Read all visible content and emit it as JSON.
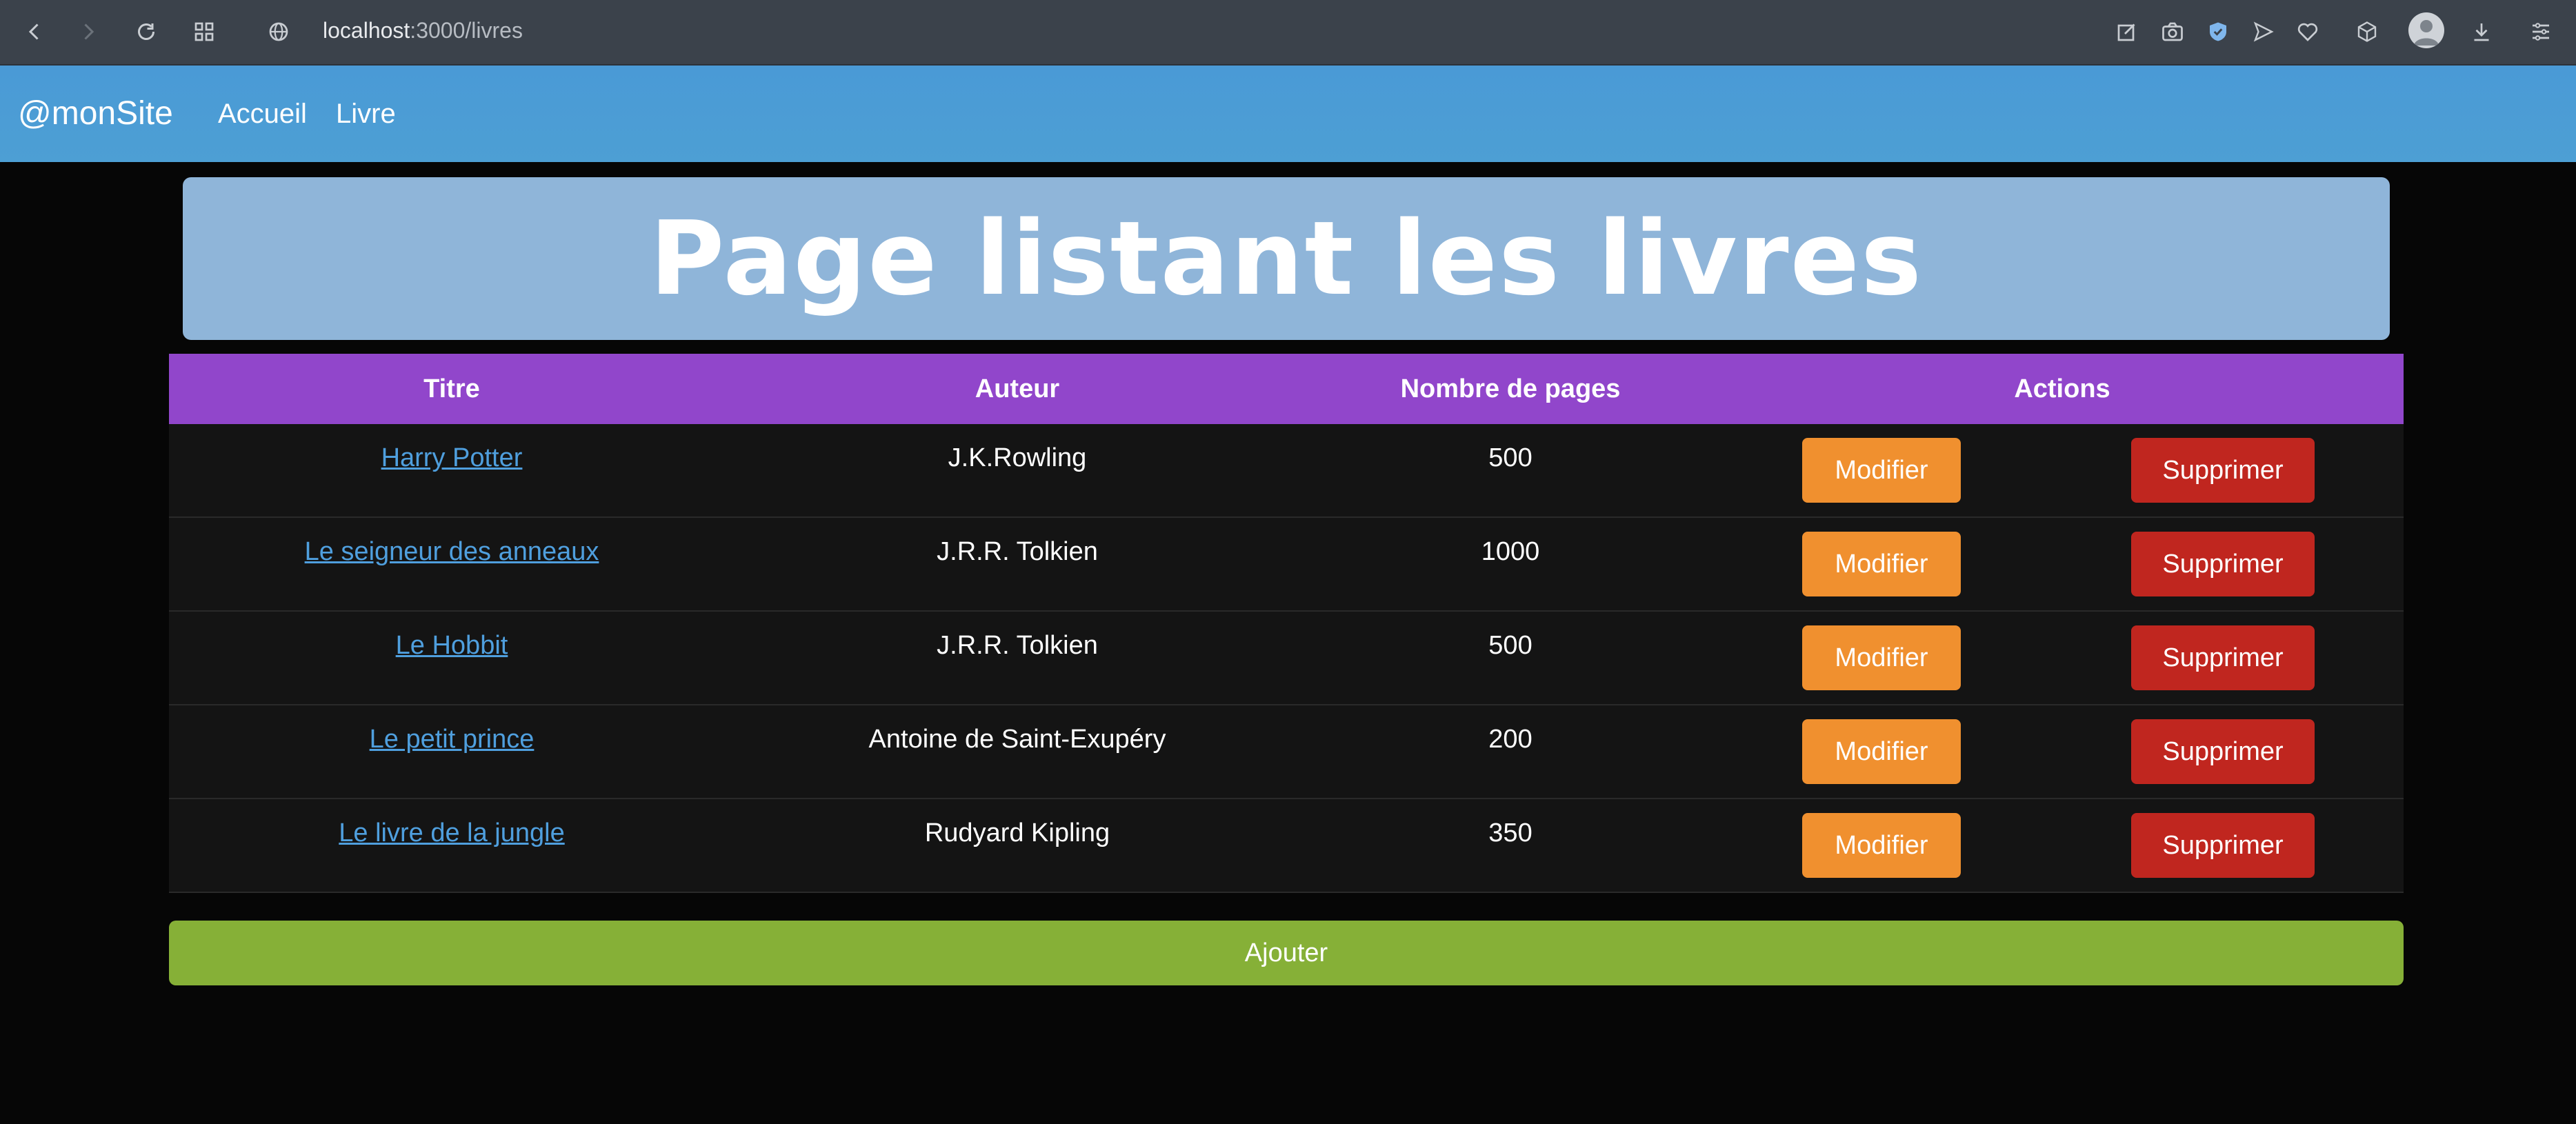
{
  "browser": {
    "url_host": "localhost",
    "url_path": ":3000/livres",
    "icons": [
      "back-icon",
      "forward-icon",
      "reload-icon",
      "grid-icon",
      "globe-icon",
      "edit-icon",
      "camera-icon",
      "shield-icon",
      "send-icon",
      "heart-icon",
      "cube-icon",
      "avatar-icon",
      "download-icon",
      "menu-icon"
    ]
  },
  "navbar": {
    "brand": "@monSite",
    "links": [
      "Accueil",
      "Livre"
    ]
  },
  "hero": {
    "title": "Page listant les livres"
  },
  "table": {
    "headers": [
      "Titre",
      "Auteur",
      "Nombre de pages",
      "Actions"
    ],
    "rows": [
      {
        "title": "Harry Potter",
        "author": "J.K.Rowling",
        "pages": "500"
      },
      {
        "title": "Le seigneur des anneaux",
        "author": "J.R.R. Tolkien",
        "pages": "1000"
      },
      {
        "title": "Le Hobbit",
        "author": "J.R.R. Tolkien",
        "pages": "500"
      },
      {
        "title": "Le petit prince",
        "author": "Antoine de Saint-Exupéry",
        "pages": "200"
      },
      {
        "title": "Le livre de la jungle",
        "author": "Rudyard Kipling",
        "pages": "350"
      }
    ],
    "edit_label": "Modifier",
    "delete_label": "Supprimer"
  },
  "add_label": "Ajouter",
  "colors": {
    "navbar": "#4d9fd4",
    "hero": "#8fb5d9",
    "table_header": "#9146cb",
    "edit": "#f0902f",
    "delete": "#c0261f",
    "add": "#86b037",
    "link": "#4f9fde"
  }
}
